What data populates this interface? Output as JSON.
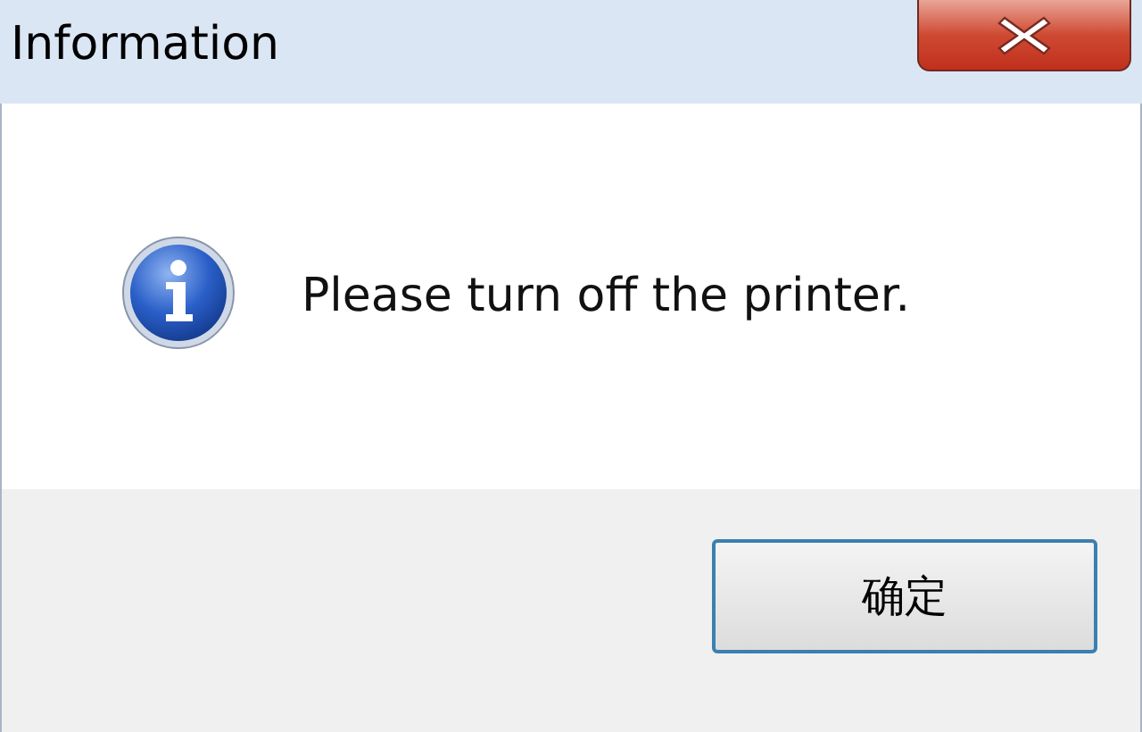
{
  "window": {
    "title": "Information"
  },
  "message": "Please turn off the printer.",
  "buttons": [
    {
      "label": "确定",
      "selected": true
    }
  ]
}
